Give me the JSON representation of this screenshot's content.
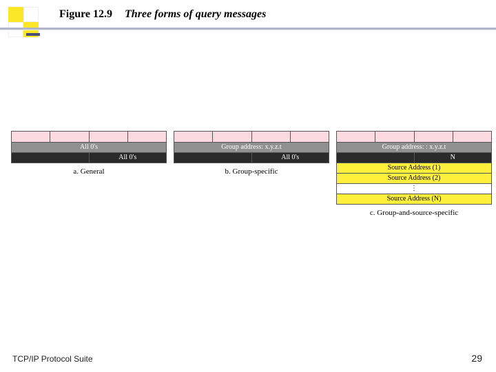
{
  "header": {
    "figure_label": "Figure 12.9",
    "figure_title": "Three forms of query messages"
  },
  "diagrams": {
    "a": {
      "caption": "a. General",
      "row2_text": "All 0's",
      "row3_text": "All 0's"
    },
    "b": {
      "caption": "b. Group-specific",
      "row2_text": "Group address: x.y.z.t",
      "row3_text": "All 0's"
    },
    "c": {
      "caption": "c. Group-and-source-specific",
      "row2_text": "Group address: : x.y.z.t",
      "n_label": "N",
      "src1": "Source Address (1)",
      "src2": "Source Address (2)",
      "ellipsis": "⋮",
      "srcN": "Source Address (N)"
    }
  },
  "footer": {
    "left": "TCP/IP Protocol Suite",
    "page": "29"
  }
}
